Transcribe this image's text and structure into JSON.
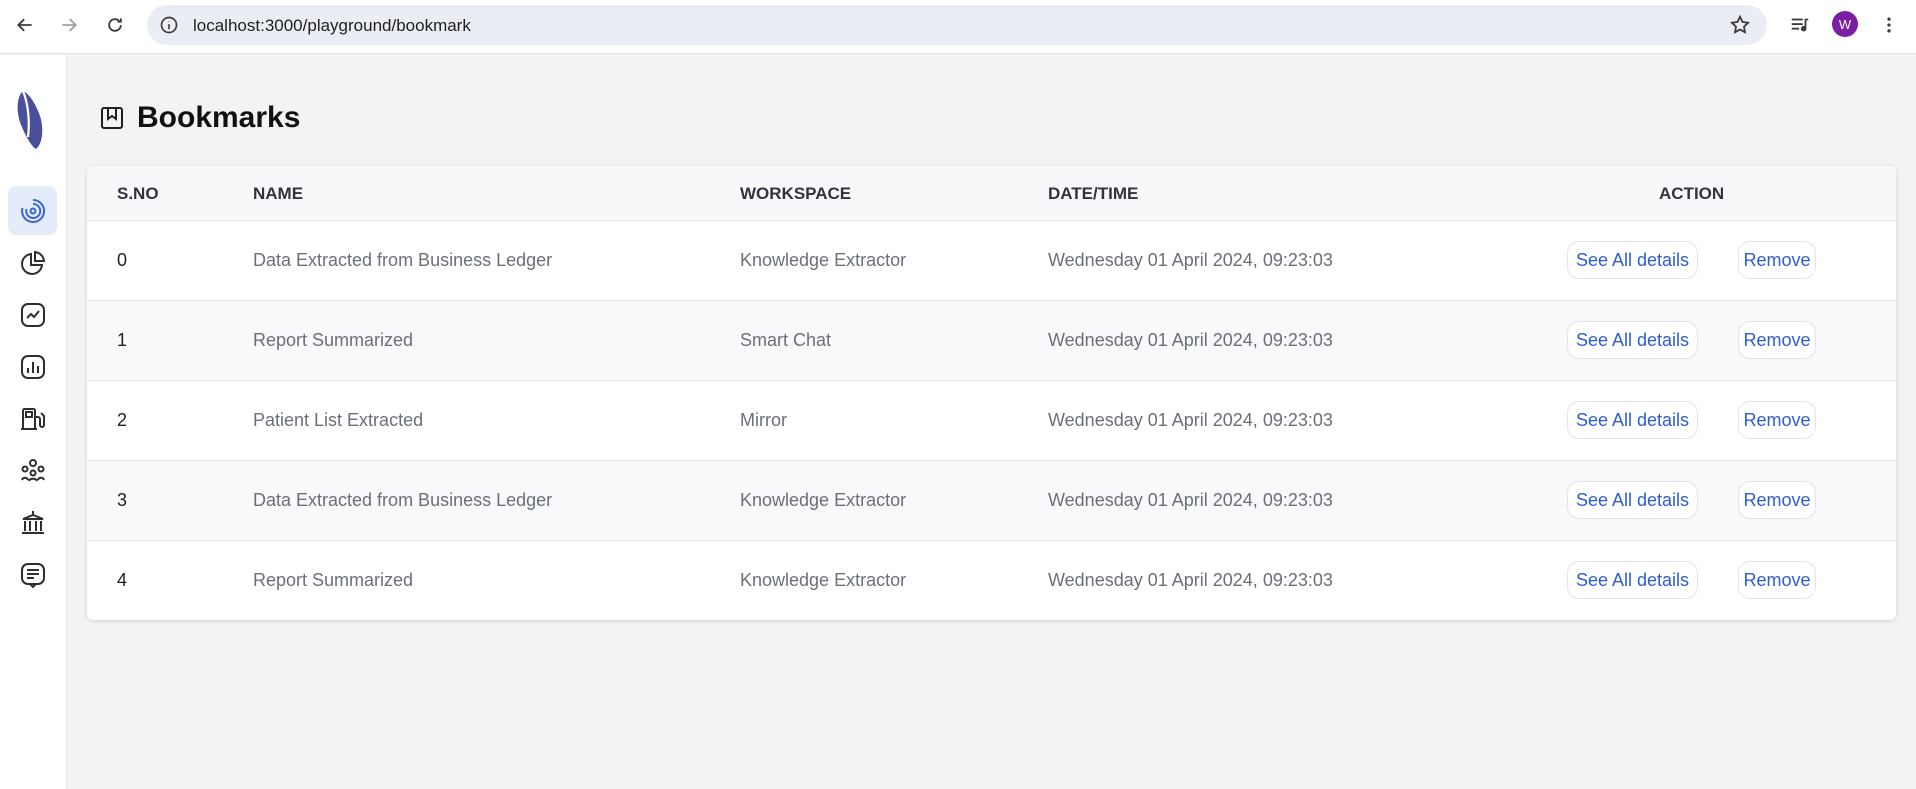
{
  "browser": {
    "url": "localhost:3000/playground/bookmark",
    "avatar_letter": "W"
  },
  "sidebar": {
    "items": [
      {
        "name": "dashboard-icon",
        "active": true
      },
      {
        "name": "pie-chart-icon",
        "active": false
      },
      {
        "name": "trend-chart-icon",
        "active": false
      },
      {
        "name": "bar-chart-icon",
        "active": false
      },
      {
        "name": "fuel-station-icon",
        "active": false
      },
      {
        "name": "team-icon",
        "active": false
      },
      {
        "name": "bank-icon",
        "active": false
      },
      {
        "name": "chat-document-icon",
        "active": false
      }
    ]
  },
  "page": {
    "title": "Bookmarks",
    "title_icon": "bookmark-icon"
  },
  "table": {
    "headers": {
      "sno": "S.NO",
      "name": "NAME",
      "workspace": "WORKSPACE",
      "datetime": "DATE/TIME",
      "action": "ACTION"
    },
    "rows": [
      {
        "sno": "0",
        "name": "Data Extracted from Business Ledger",
        "workspace": "Knowledge Extractor",
        "datetime": "Wednesday 01 April 2024, 09:23:03",
        "details": "See All details",
        "remove": "Remove"
      },
      {
        "sno": "1",
        "name": "Report Summarized",
        "workspace": "Smart Chat",
        "datetime": "Wednesday 01 April 2024, 09:23:03",
        "details": "See All details",
        "remove": "Remove"
      },
      {
        "sno": "2",
        "name": "Patient List Extracted",
        "workspace": "Mirror",
        "datetime": "Wednesday 01 April 2024, 09:23:03",
        "details": "See All details",
        "remove": "Remove"
      },
      {
        "sno": "3",
        "name": "Data Extracted from Business Ledger",
        "workspace": "Knowledge Extractor",
        "datetime": "Wednesday 01 April 2024, 09:23:03",
        "details": "See All details",
        "remove": "Remove"
      },
      {
        "sno": "4",
        "name": "Report Summarized",
        "workspace": "Knowledge Extractor",
        "datetime": "Wednesday 01 April 2024, 09:23:03",
        "details": "See All details",
        "remove": "Remove"
      }
    ]
  },
  "colors": {
    "accent": "#2c5cd6",
    "active_bg": "#e4ebf9",
    "logo": "#4a4f9c",
    "avatar": "#7b1fa2"
  }
}
